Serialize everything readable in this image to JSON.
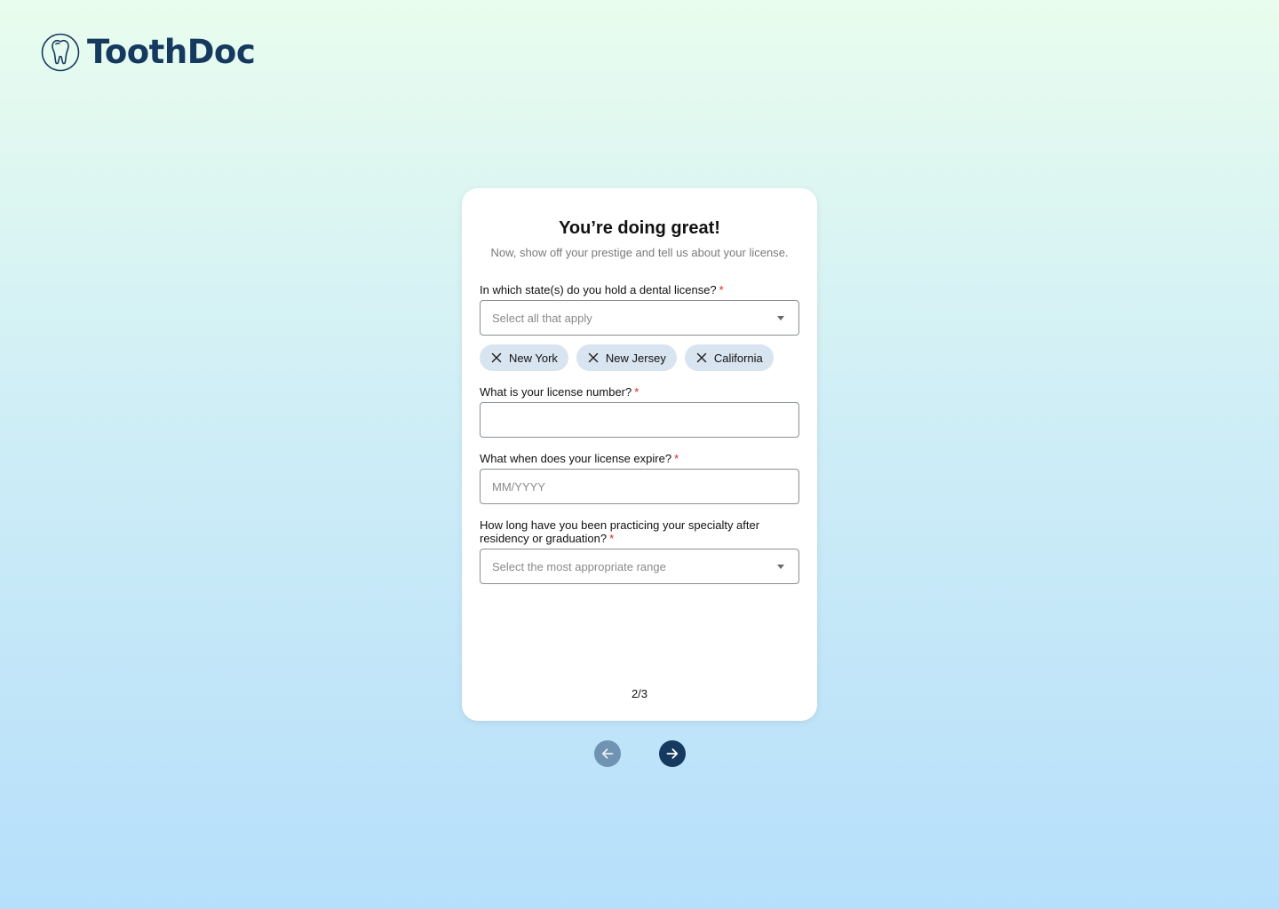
{
  "brand": {
    "name": "ToothDoc",
    "color": "#163a5f"
  },
  "card": {
    "title": "You’re doing great!",
    "subtitle": "Now, show off your prestige and tell us about your license.",
    "step": "2/3"
  },
  "form": {
    "states": {
      "label": "In which state(s) do you hold a dental license?",
      "required_mark": "*",
      "placeholder": "Select all that apply",
      "selected": [
        "New York",
        "New Jersey",
        "California"
      ]
    },
    "license_number": {
      "label": "What is your license number?",
      "required_mark": "*",
      "value": "",
      "placeholder": ""
    },
    "license_expiry": {
      "label": "What when does your license expire?",
      "required_mark": "*",
      "value": "",
      "placeholder": "MM/YYYY"
    },
    "practice_length": {
      "label": "How long have you been practicing your specialty after residency or graduation?",
      "required_mark": "*",
      "placeholder": "Select the most appropriate range"
    }
  },
  "navigation": {
    "back_icon": "arrow-left-icon",
    "next_icon": "arrow-right-icon"
  },
  "colors": {
    "required": "#e02020",
    "chip_bg": "#d8e4f0",
    "back_button": "#6f93b0",
    "next_button": "#163a5f"
  }
}
